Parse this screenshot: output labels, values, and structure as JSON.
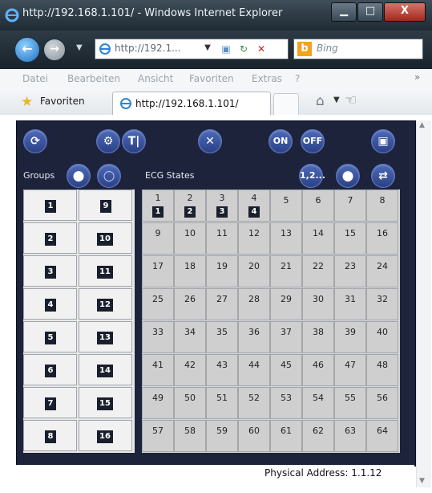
{
  "window": {
    "title": "http://192.168.1.101/ - Windows Internet Explorer",
    "min_glyph": "▁",
    "max_glyph": "□",
    "close_glyph": "X"
  },
  "address_bar": {
    "url": "http://192.1...",
    "search_placeholder": "Bing"
  },
  "menu": [
    "Datei",
    "Bearbeiten",
    "Ansicht",
    "Favoriten",
    "Extras",
    "?"
  ],
  "favorites_bar": {
    "favorites_label": "Favoriten",
    "tab_label": "http://192.168.1.101/"
  },
  "toolbar": {
    "on_label": "ON",
    "off_label": "OFF"
  },
  "groups": {
    "label": "Groups",
    "items": [
      "1",
      "9",
      "2",
      "10",
      "3",
      "11",
      "4",
      "12",
      "5",
      "13",
      "6",
      "14",
      "7",
      "15",
      "8",
      "16"
    ]
  },
  "ecg": {
    "label": "ECG States",
    "sequence_label": "1,2...",
    "cells": [
      "1",
      "2",
      "3",
      "4",
      "5",
      "6",
      "7",
      "8",
      "9",
      "10",
      "11",
      "12",
      "13",
      "14",
      "15",
      "16",
      "17",
      "18",
      "19",
      "20",
      "21",
      "22",
      "23",
      "24",
      "25",
      "26",
      "27",
      "28",
      "29",
      "30",
      "31",
      "32",
      "33",
      "34",
      "35",
      "36",
      "37",
      "38",
      "39",
      "40",
      "41",
      "42",
      "43",
      "44",
      "45",
      "46",
      "47",
      "48",
      "49",
      "50",
      "51",
      "52",
      "53",
      "54",
      "55",
      "56",
      "57",
      "58",
      "59",
      "60",
      "61",
      "62",
      "63",
      "64"
    ],
    "marks": [
      "1",
      "2",
      "3",
      "4"
    ]
  },
  "status": {
    "physical_address": "Physical Address: 1.1.12"
  },
  "colors": {
    "panel_bg": "#1d233b",
    "button_blue": "#3a56a6",
    "cell_gray": "#cfcfcf",
    "badge_dark": "#1a1f2e"
  }
}
